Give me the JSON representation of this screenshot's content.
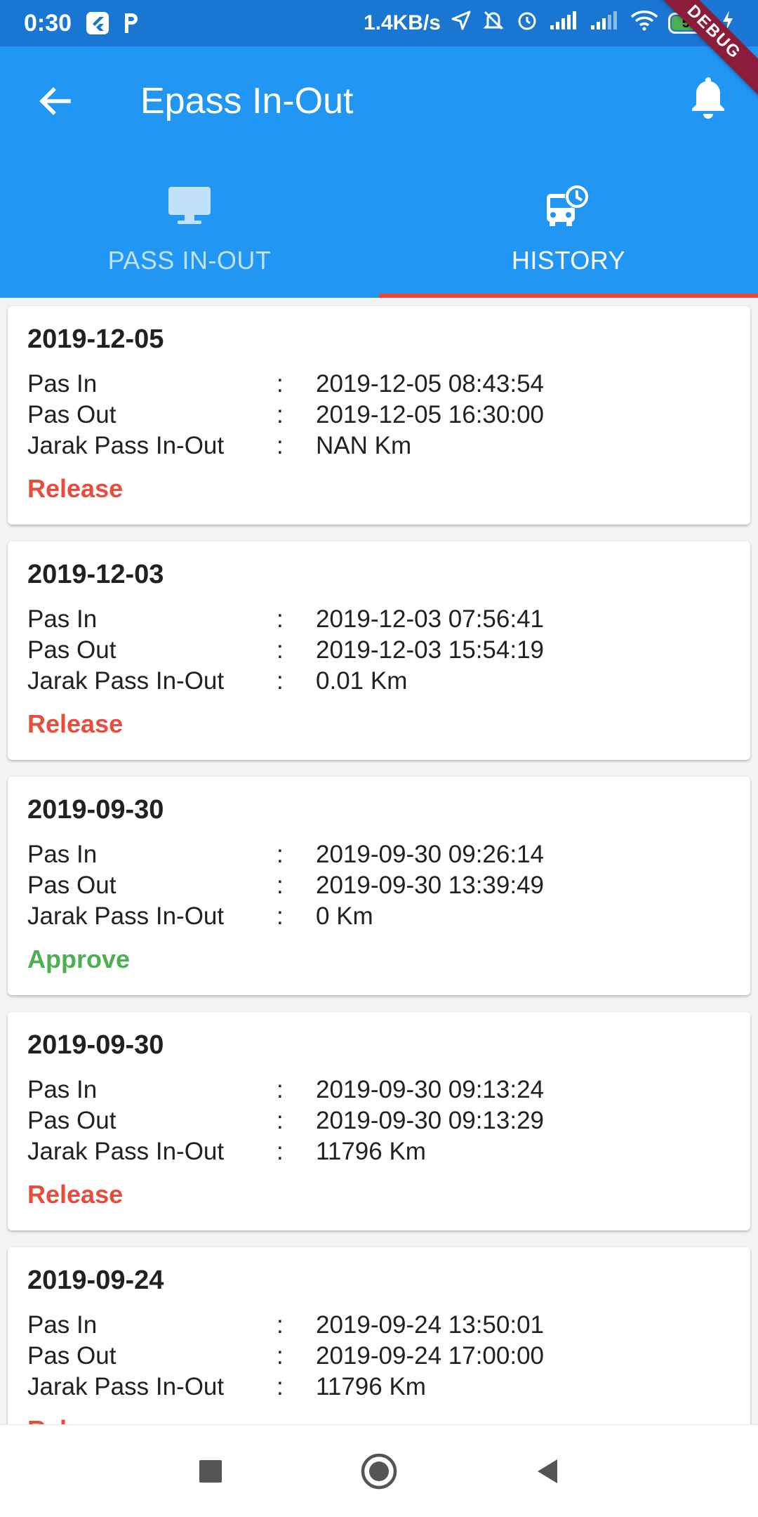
{
  "status_bar": {
    "time": "0:30",
    "network_speed": "1.4KB/s",
    "battery_level": "51"
  },
  "debug_banner": "DEBUG",
  "app_bar": {
    "title": "Epass In-Out",
    "back_icon": "arrow-back-icon",
    "notification_icon": "bell-icon"
  },
  "tabs": [
    {
      "label": "PASS IN-OUT",
      "icon": "monitor-icon",
      "active": false
    },
    {
      "label": "HISTORY",
      "icon": "bus-clock-icon",
      "active": true
    }
  ],
  "labels": {
    "pass_in": "Pas In",
    "pass_out": "Pas Out",
    "distance": "Jarak Pass In-Out",
    "separator": ":"
  },
  "history": [
    {
      "date": "2019-12-05",
      "pass_in": "2019-12-05 08:43:54",
      "pass_out": "2019-12-05 16:30:00",
      "distance": "NAN Km",
      "status": "Release"
    },
    {
      "date": "2019-12-03",
      "pass_in": "2019-12-03 07:56:41",
      "pass_out": "2019-12-03 15:54:19",
      "distance": "0.01 Km",
      "status": "Release"
    },
    {
      "date": "2019-09-30",
      "pass_in": "2019-09-30 09:26:14",
      "pass_out": "2019-09-30 13:39:49",
      "distance": "0 Km",
      "status": "Approve"
    },
    {
      "date": "2019-09-30",
      "pass_in": "2019-09-30 09:13:24",
      "pass_out": "2019-09-30 09:13:29",
      "distance": "11796 Km",
      "status": "Release"
    },
    {
      "date": "2019-09-24",
      "pass_in": "2019-09-24 13:50:01",
      "pass_out": "2019-09-24 17:00:00",
      "distance": "11796 Km",
      "status": "Release"
    }
  ],
  "colors": {
    "primary": "#2196F3",
    "status_bar": "#1976D2",
    "tab_indicator": "#F44336",
    "release": "#E74C3C",
    "approve": "#4CAF50"
  },
  "nav_bar": [
    "square-icon",
    "circle-home-icon",
    "triangle-back-icon"
  ]
}
